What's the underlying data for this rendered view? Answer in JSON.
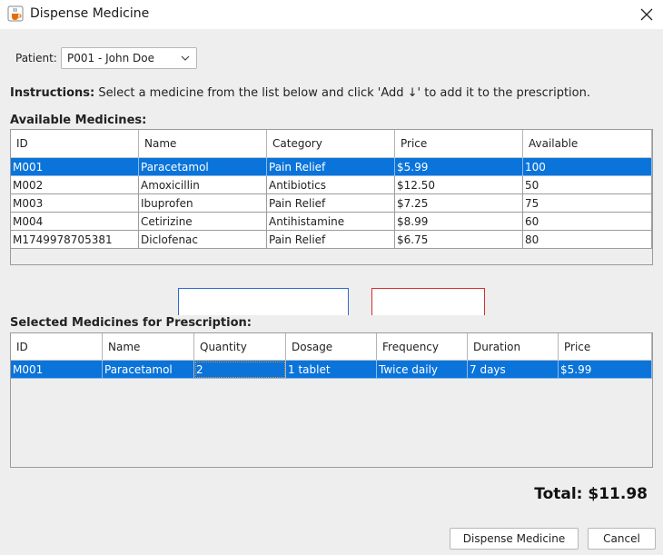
{
  "window": {
    "title": "Dispense Medicine",
    "icon": "java-cup-icon",
    "close_icon": "close-icon"
  },
  "patient": {
    "label": "Patient:",
    "selected": "P001 - John Doe"
  },
  "instructions": {
    "bold": "Instructions:",
    "text": " Select a medicine from the list below and click 'Add ↓' to add it to the prescription."
  },
  "available": {
    "title": "Available Medicines:",
    "columns": [
      "ID",
      "Name",
      "Category",
      "Price",
      "Available"
    ],
    "rows": [
      [
        "M001",
        "Paracetamol",
        "Pain Relief",
        "$5.99",
        "100"
      ],
      [
        "M002",
        "Amoxicillin",
        "Antibiotics",
        "$12.50",
        "50"
      ],
      [
        "M003",
        "Ibuprofen",
        "Pain Relief",
        "$7.25",
        "75"
      ],
      [
        "M004",
        "Cetirizine",
        "Antihistamine",
        "$8.99",
        "60"
      ],
      [
        "M1749978705381",
        "Diclofenac",
        "Pain Relief",
        "$6.75",
        "80"
      ]
    ],
    "selected_row": 0
  },
  "selected": {
    "title": "Selected Medicines for Prescription:",
    "columns": [
      "ID",
      "Name",
      "Quantity",
      "Dosage",
      "Frequency",
      "Duration",
      "Price"
    ],
    "rows": [
      [
        "M001",
        "Paracetamol",
        "2",
        "1 tablet",
        "Twice daily",
        "7 days",
        "$5.99"
      ]
    ],
    "selected_row": 0
  },
  "total": "Total: $11.98",
  "buttons": {
    "dispense": "Dispense Medicine",
    "cancel": "Cancel"
  },
  "colors": {
    "selection": "#0a74da",
    "background": "#eeeeee",
    "add_border": "#2f6ad0",
    "remove_border": "#d0322f"
  }
}
